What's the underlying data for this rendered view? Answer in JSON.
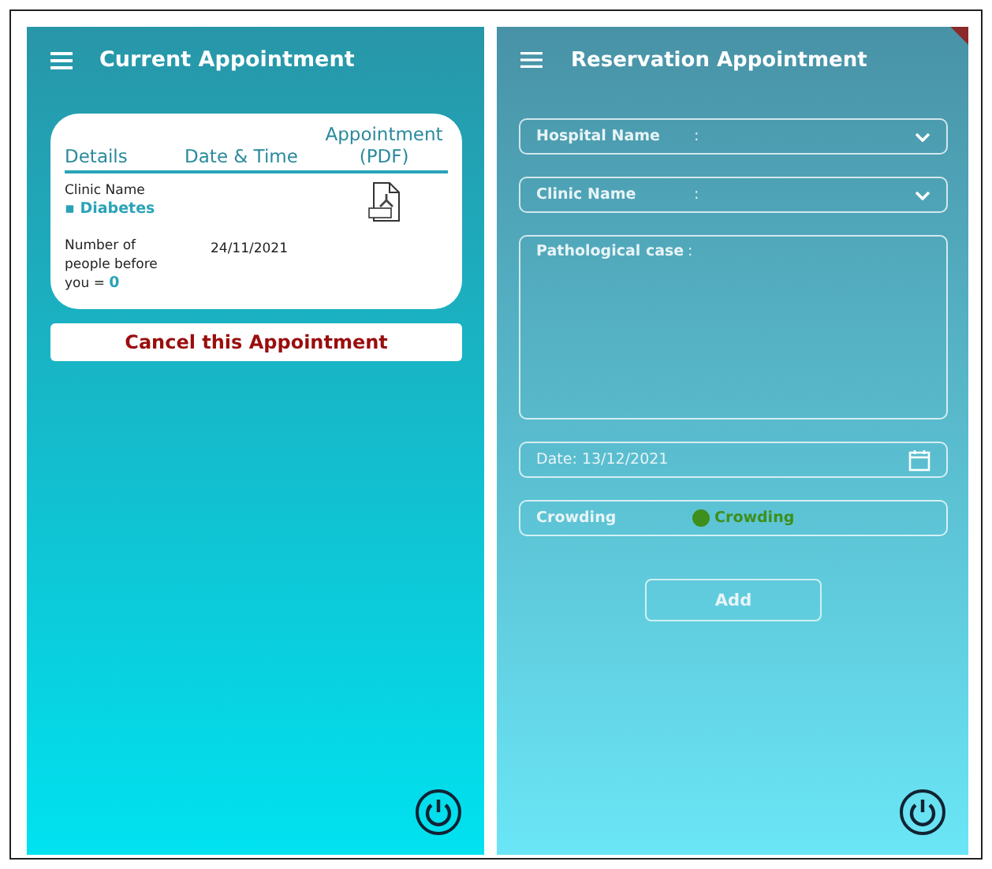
{
  "current_screen": {
    "title": "Current Appointment",
    "table": {
      "columns": [
        "Details",
        "Date & Time",
        "Appointment (PDF)"
      ],
      "clinic_label": "Clinic Name",
      "clinic_value": "▪ Diabetes",
      "queue_label": "Number of people before you =",
      "queue_value": "0",
      "date": "24/11/2021"
    },
    "cancel_button": "Cancel this Appointment"
  },
  "reservation_screen": {
    "title": "Reservation Appointment",
    "fields": [
      {
        "kind": "dropdown",
        "label": "Hospital Name",
        "separator": ":"
      },
      {
        "kind": "dropdown",
        "label": "Clinic Name",
        "separator": ":"
      },
      {
        "kind": "textarea",
        "label": "Pathological case",
        "separator": ":"
      },
      {
        "kind": "date",
        "label": "Date: 13/12/2021"
      },
      {
        "kind": "status",
        "label": "Crowding",
        "status": "Crowding",
        "color": "#3e8f1c"
      }
    ],
    "add_button": "Add"
  }
}
